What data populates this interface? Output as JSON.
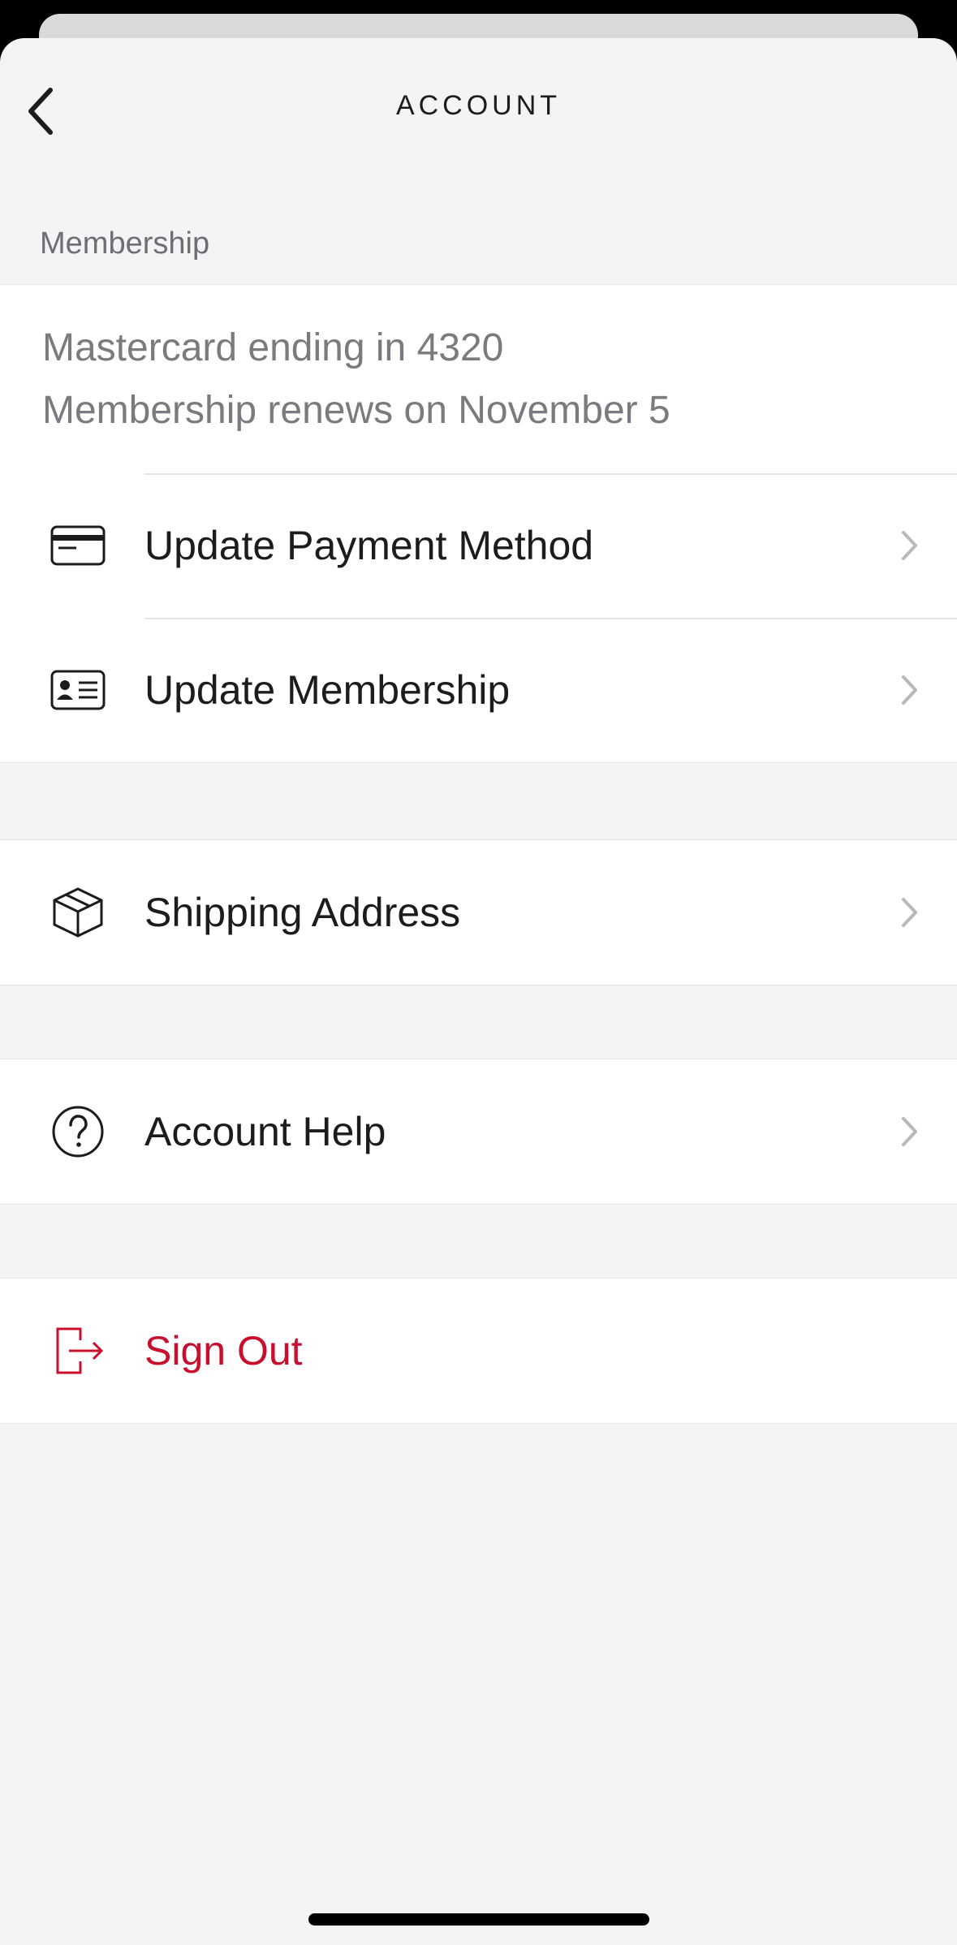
{
  "nav": {
    "title": "ACCOUNT",
    "back_icon": "chevron-left-icon"
  },
  "membership": {
    "section_label": "Membership",
    "payment_summary": "Mastercard ending in 4320",
    "renewal_summary": "Membership renews on November 5"
  },
  "rows": {
    "update_payment": {
      "label": "Update Payment Method",
      "icon": "credit-card-icon"
    },
    "update_membership": {
      "label": "Update Membership",
      "icon": "id-card-icon"
    },
    "shipping_address": {
      "label": "Shipping Address",
      "icon": "package-box-icon"
    },
    "account_help": {
      "label": "Account Help",
      "icon": "help-circle-icon"
    },
    "sign_out": {
      "label": "Sign Out",
      "icon": "sign-out-icon"
    }
  },
  "colors": {
    "background": "#f3f4f6",
    "surface": "#ffffff",
    "text_primary": "#1c1c1e",
    "text_secondary": "#7a7a7f",
    "danger": "#c8102e",
    "chevron": "#b8b8bd"
  }
}
